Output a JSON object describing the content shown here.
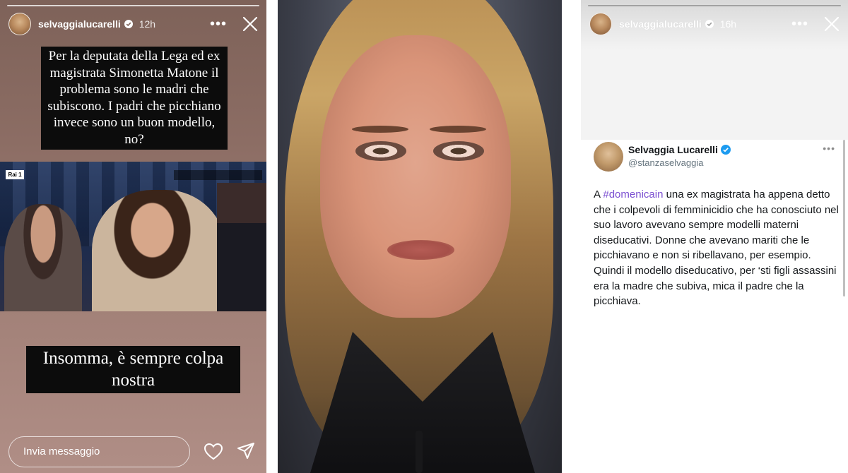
{
  "left_story": {
    "username": "selvaggialucarelli",
    "time": "12h",
    "progress_segments": 1,
    "caption_top": "Per la deputata della Lega ed ex magistrata Simonetta Matone il problema sono le madri che subiscono. I padri che picchiano invece sono un buon modello, no?",
    "caption_bottom": "Insomma, è sempre colpa nostra",
    "reply_placeholder": "Invia messaggio"
  },
  "right_story": {
    "username": "selvaggialucarelli",
    "time": "16h",
    "progress_segments": 1
  },
  "tweet": {
    "name": "Selvaggia Lucarelli",
    "handle": "@stanzaselvaggia",
    "text_prefix": "A ",
    "hashtag": "#domenicain",
    "text_body": " una ex magistrata ha appena detto che i colpevoli di femminicidio che ha conosciuto nel suo lavoro avevano sempre modelli materni diseducativi. Donne che avevano mariti che le picchiavano e non si ribellavano, per esempio.",
    "text_body_2": "Quindi il modello diseducativo, per ‘sti figli assassini era la madre che subiva, mica il padre che la picchiava."
  },
  "colors": {
    "hashtag": "#7b4fd1",
    "verified": "#1d9bf0",
    "caption_bg": "#0c0c0c"
  },
  "icons": {
    "more": "more-dots-icon",
    "close": "close-icon",
    "like": "heart-icon",
    "share": "send-icon",
    "verified": "verified-badge-icon"
  }
}
